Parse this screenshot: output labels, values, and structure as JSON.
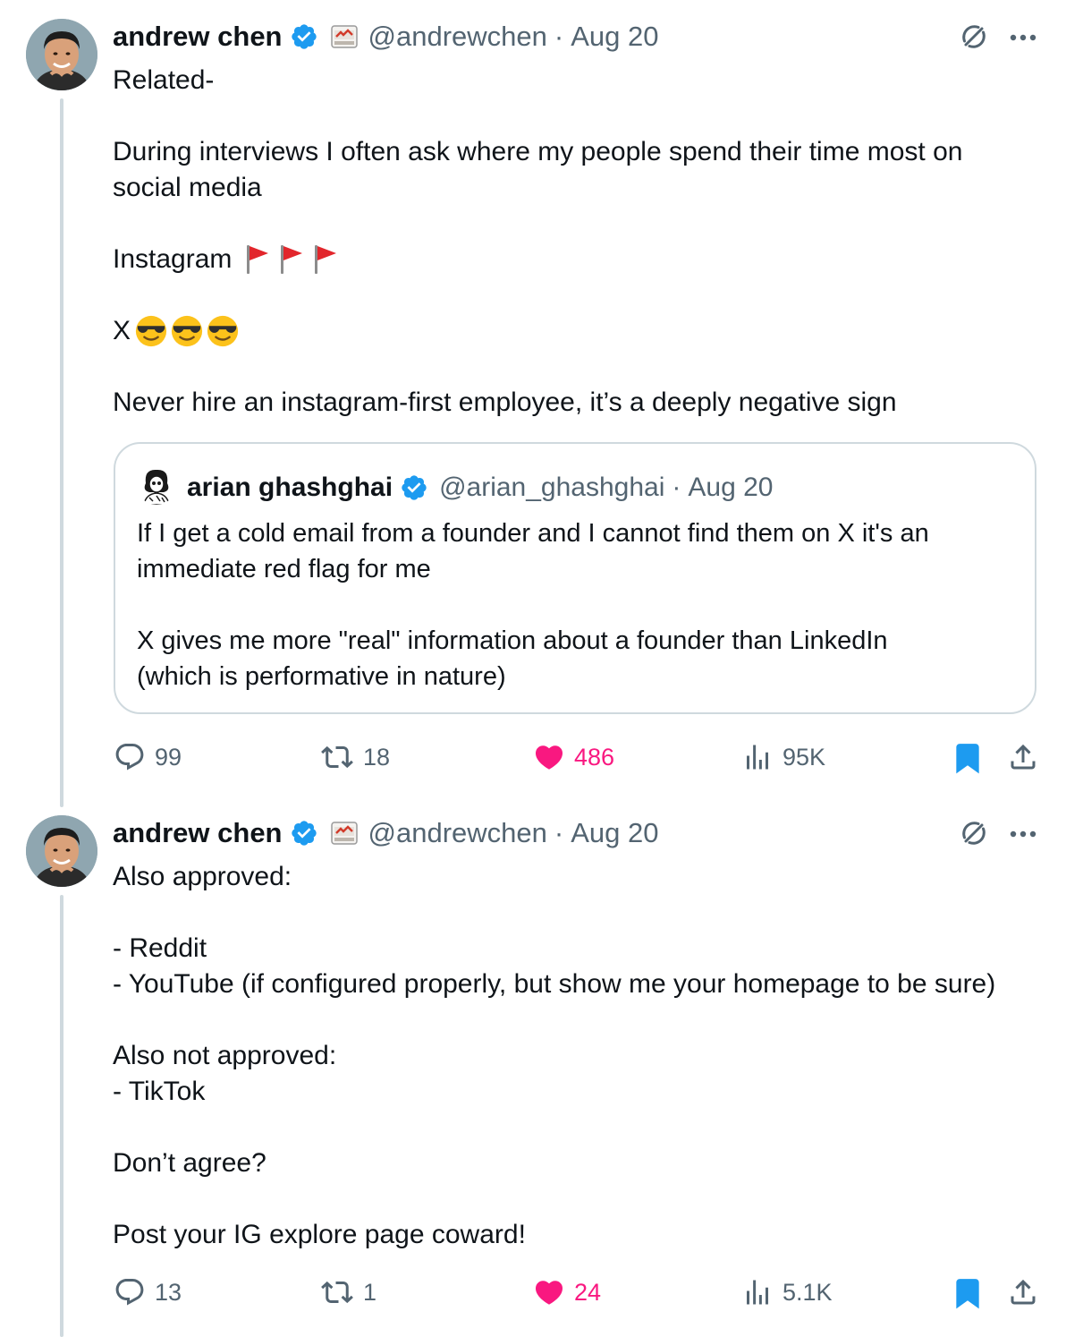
{
  "tweet1": {
    "name": "andrew chen",
    "handle": "@andrewchen",
    "separator": "·",
    "date": "Aug 20",
    "line_related": "Related-",
    "line_interviews": "During interviews I often ask where my people spend their time most on\nsocial media",
    "line_instagram": "Instagram",
    "line_x": "X",
    "line_never": "Never hire an instagram-first employee, it’s a deeply negative sign",
    "emoji_instagram": "red-flag-icon x3",
    "emoji_x": "sunglasses-face-icon x3",
    "quote": {
      "name": "arian ghashghai",
      "handle": "@arian_ghashghai",
      "separator": "·",
      "date": "Aug 20",
      "text": "If I get a cold email from a founder and I cannot find them on X it's an\nimmediate red flag for me\n\nX gives me more \"real\" information about a founder than LinkedIn\n(which is performative in nature)"
    },
    "actions": {
      "replies": "99",
      "reposts": "18",
      "likes": "486",
      "views": "95K"
    }
  },
  "tweet2": {
    "name": "andrew chen",
    "handle": "@andrewchen",
    "separator": "·",
    "date": "Aug 20",
    "text": "Also approved:\n\n- Reddit\n- YouTube (if configured properly, but show me your homepage to be sure)\n\nAlso not approved:\n- TikTok\n\nDon’t agree?\n\nPost your IG explore page coward!",
    "actions": {
      "replies": "13",
      "reposts": "1",
      "likes": "24",
      "views": "5.1K"
    }
  },
  "colors": {
    "text": "#0f1419",
    "secondary": "#536471",
    "verified": "#1d9bf0",
    "like": "#f91880",
    "bookmark": "#1d9bf0",
    "thread_line": "#cfd9de"
  }
}
